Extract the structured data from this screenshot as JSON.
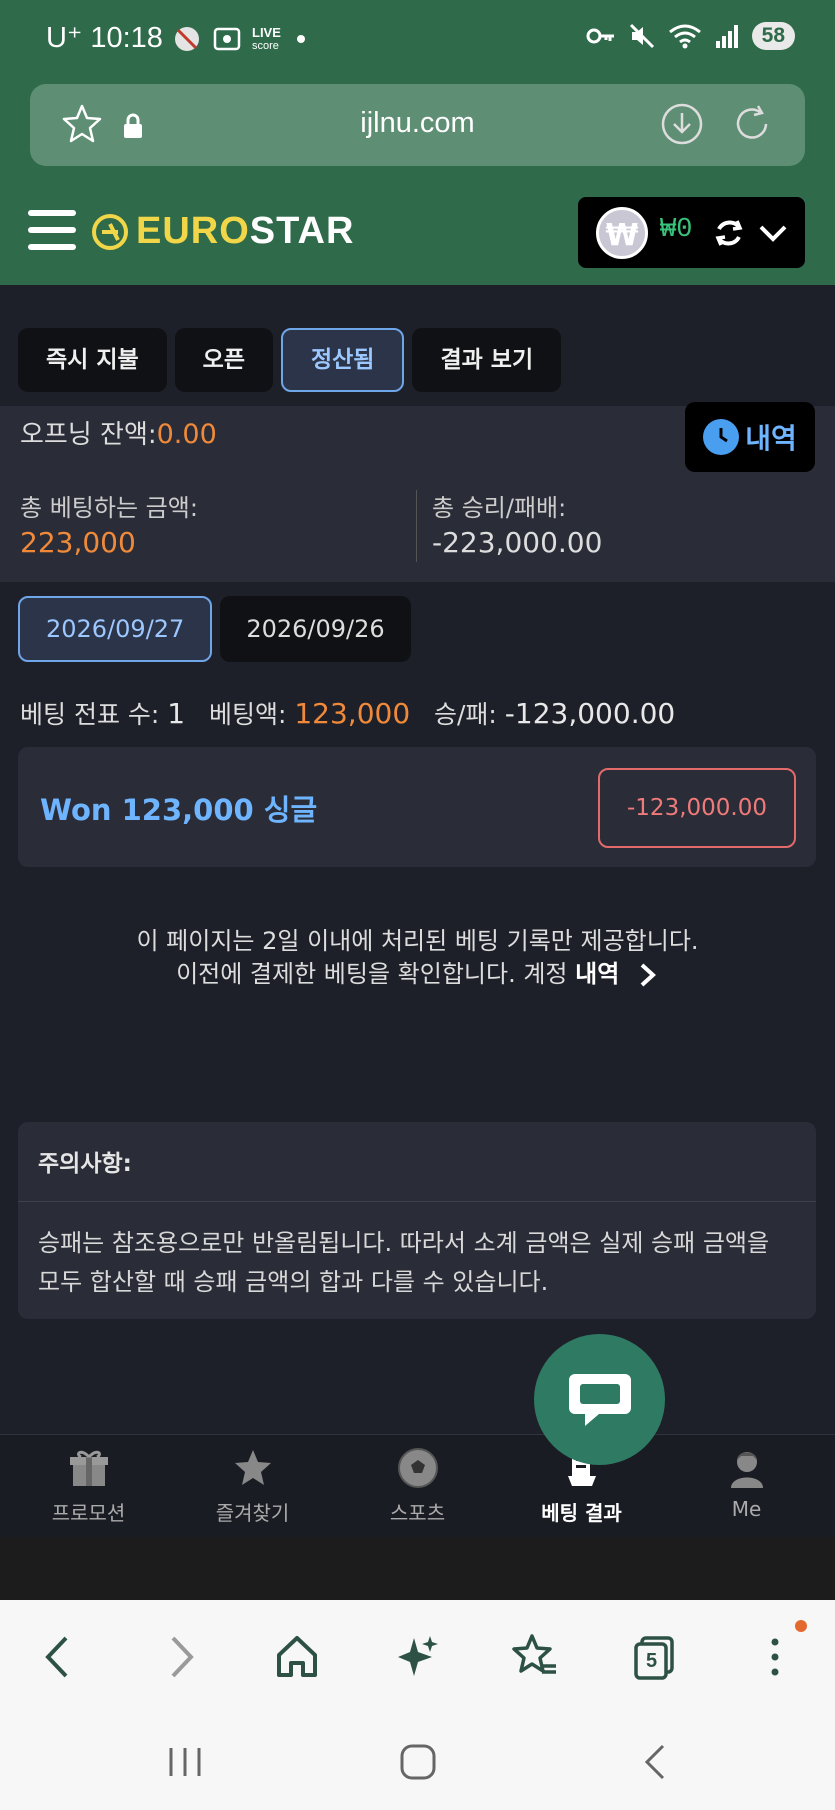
{
  "status_bar": {
    "carrier": "U⁺",
    "time": "10:18",
    "live_label": "LIVE",
    "score_label": "score",
    "battery": "58"
  },
  "browser": {
    "url": "ijlnu.com",
    "tab_count": "5"
  },
  "header": {
    "logo_part1": "EURO",
    "logo_part2": "STAR",
    "currency_symbol": "₩",
    "balance": "₩0"
  },
  "tabs": [
    {
      "label": "즉시 지불",
      "active": false
    },
    {
      "label": "오픈",
      "active": false
    },
    {
      "label": "정산됨",
      "active": true
    },
    {
      "label": "결과 보기",
      "active": false
    }
  ],
  "summary": {
    "opening_label": "오프닝 잔액:",
    "opening_value": "0.00",
    "history_button": "내역",
    "stake_label": "총 베팅하는 금액:",
    "stake_value": "223,000",
    "winloss_label": "총 승리/패배:",
    "winloss_value": "-223,000.00"
  },
  "dates": [
    {
      "label": "2026/09/27",
      "active": true
    },
    {
      "label": "2026/09/26",
      "active": false
    }
  ],
  "bet_info": {
    "count_label": "베팅 전표 수:",
    "count_value": "1",
    "amount_label": "베팅액:",
    "amount_value": "123,000",
    "wl_label": "승/패:",
    "wl_value": "-123,000.00"
  },
  "bet_card": {
    "title": "Won 123,000 싱글",
    "result": "-123,000.00"
  },
  "notice": {
    "line1": "이 페이지는 2일 이내에 처리된 베팅 기록만 제공합니다.",
    "line2": "이전에 결제한 베팅을 확인합니다. 계정 내역",
    "link": "내역"
  },
  "caution": {
    "title": "주의사항:",
    "body": "승패는 참조용으로만 반올림됩니다. 따라서 소계 금액은 실제 승패 금액을 모두 합산할 때 승패 금액의 합과 다를 수 있습니다."
  },
  "bottom_nav": [
    {
      "label": "프로모션",
      "icon": "gift-icon",
      "active": false
    },
    {
      "label": "즐겨찾기",
      "icon": "star-icon",
      "active": false
    },
    {
      "label": "스포츠",
      "icon": "soccer-ball-icon",
      "active": false
    },
    {
      "label": "베팅 결과",
      "icon": "receipt-icon",
      "active": true
    },
    {
      "label": "Me",
      "icon": "user-avatar-icon",
      "active": false
    }
  ],
  "colors": {
    "header_green": "#2f6b4a",
    "accent_orange": "#f08a3a",
    "accent_blue": "#6fb4ff",
    "loss_red": "#f07a7a",
    "balance_green": "#37c37a"
  }
}
